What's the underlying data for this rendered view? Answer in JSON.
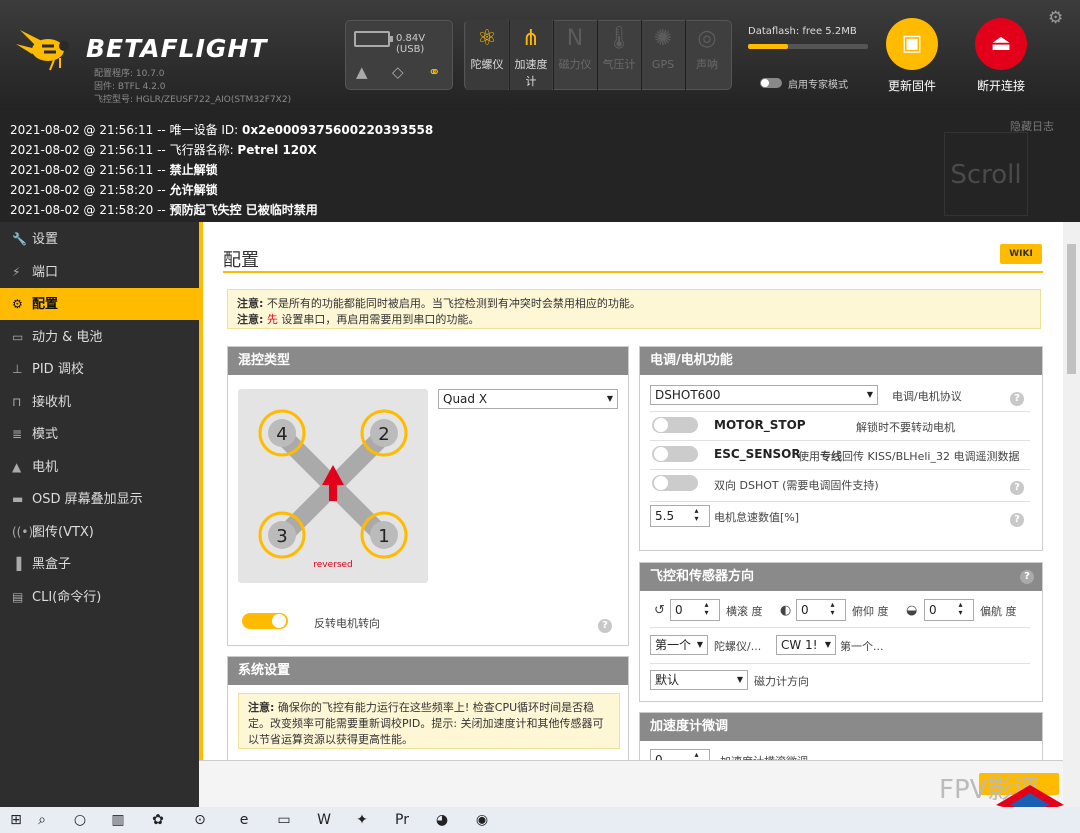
{
  "app": {
    "brand": "BETAFLIGHT",
    "configurator_version": "配置程序: 10.7.0",
    "firmware": "固件: BTFL 4.2.0",
    "board": "飞控型号: HGLR/ZEUSF722_AIO(STM32F7X2)"
  },
  "status": {
    "battery_voltage": "0.84V (USB)",
    "dataflash_label": "Dataflash: free 5.2MB",
    "dataflash_used_fraction": 0.33,
    "expert_mode_label": "启用专家模式"
  },
  "sensors": [
    {
      "label": "陀螺仪",
      "icon": "gyro-icon",
      "active": true
    },
    {
      "label": "加速度计",
      "icon": "accelerometer-icon",
      "active": true
    },
    {
      "label": "磁力仪",
      "icon": "magnetometer-icon",
      "active": false
    },
    {
      "label": "气压计",
      "icon": "barometer-icon",
      "active": false
    },
    {
      "label": "GPS",
      "icon": "gps-icon",
      "active": false
    },
    {
      "label": "声呐",
      "icon": "sonar-icon",
      "active": false
    }
  ],
  "header_buttons": {
    "update_firmware": "更新固件",
    "disconnect": "断开连接",
    "update_color": "#ffbb00",
    "disconnect_color": "#e2001a"
  },
  "log": {
    "hide_label": "隐藏日志",
    "scroll_label": "Scroll",
    "lines": [
      {
        "ts": "2021-08-02 @ 21:56:11 -- ",
        "text": "唯一设备 ID: ",
        "bold": "0x2e0009375600220393558"
      },
      {
        "ts": "2021-08-02 @ 21:56:11 -- ",
        "text": "飞行器名称: ",
        "bold": "Petrel 120X"
      },
      {
        "ts": "2021-08-02 @ 21:56:11 -- ",
        "text": "",
        "bold": "禁止解锁"
      },
      {
        "ts": "2021-08-02 @ 21:58:20 -- ",
        "text": "",
        "bold": "允许解锁"
      },
      {
        "ts": "2021-08-02 @ 21:58:20 -- ",
        "text": "",
        "bold": "预防起飞失控 已被临时禁用"
      }
    ]
  },
  "nav": [
    {
      "label": "设置",
      "icon": "wrench-icon"
    },
    {
      "label": "端口",
      "icon": "plug-icon"
    },
    {
      "label": "配置",
      "icon": "gear-icon",
      "active": true
    },
    {
      "label": "动力 & 电池",
      "icon": "battery-icon"
    },
    {
      "label": "PID 调校",
      "icon": "pid-icon"
    },
    {
      "label": "接收机",
      "icon": "receiver-icon"
    },
    {
      "label": "模式",
      "icon": "modes-icon"
    },
    {
      "label": "电机",
      "icon": "motor-icon"
    },
    {
      "label": "OSD 屏幕叠加显示",
      "icon": "osd-icon"
    },
    {
      "label": "图传(VTX)",
      "icon": "vtx-icon"
    },
    {
      "label": "黑盒子",
      "icon": "blackbox-icon"
    },
    {
      "label": "CLI(命令行)",
      "icon": "cli-icon"
    }
  ],
  "page": {
    "title": "配置",
    "wiki": "WIKI",
    "note1_label": "注意:",
    "note1_text": " 不是所有的功能都能同时被启用。当飞控检测到有冲突时会禁用相应的功能。",
    "note2_label": "注意:",
    "note2_red": " 先",
    "note2_text": " 设置串口，再启用需要用到串口的功能。"
  },
  "mixer": {
    "header": "混控类型",
    "type": "Quad X",
    "reversed_label": "reversed",
    "motors": [
      "4",
      "2",
      "3",
      "1"
    ],
    "reverse_label": "反转电机转向",
    "reverse_on": true
  },
  "esc": {
    "header": "电调/电机功能",
    "protocol": "DSHOT600",
    "protocol_label": "电调/电机协议",
    "motor_stop": "MOTOR_STOP",
    "motor_stop_desc": "解锁时不要转动电机",
    "esc_sensor": "ESC_SENSOR",
    "esc_sensor_desc1": "使用",
    "esc_sensor_desc_bold": "专线",
    "esc_sensor_desc2": "回传 KISS/BLHeli_32 电调遥测数据",
    "bidir": "双向 DSHOT (需要电调固件支持)",
    "idle_value": "5.5",
    "idle_label": "电机怠速数值[%]"
  },
  "system": {
    "header": "系统设置",
    "note_label": "注意:",
    "note_text": " 确保你的飞控有能力运行在这些频率上! 检查CPU循环时间是否稳定。改变频率可能需要重新调校PID。提示: 关闭加速度计和其他传感器可以节省运算资源以获得更高性能。"
  },
  "orientation": {
    "header": "飞控和传感器方向",
    "roll_value": "0",
    "roll_label": "横滚 度",
    "pitch_value": "0",
    "pitch_label": "俯仰 度",
    "yaw_value": "0",
    "yaw_label": "偏航 度",
    "gyro_select": "第一个",
    "gyro_label": "陀螺仪/...",
    "align_select": "CW 1!",
    "align_label": "第一个...",
    "mag_select": "默认",
    "mag_label": "磁力计方向"
  },
  "accel": {
    "header": "加速度计微调",
    "value": "0",
    "label": "加速度计横滚微调"
  },
  "watermark": "FPV影评",
  "taskbar_icons": [
    "start-icon",
    "search-icon",
    "cortana-icon",
    "taskview-icon",
    "app-icon",
    "search2-icon",
    "edge-icon",
    "explorer-icon",
    "app2-icon",
    "betaflight-icon",
    "premiere-icon",
    "paint-icon",
    "chrome-icon"
  ]
}
